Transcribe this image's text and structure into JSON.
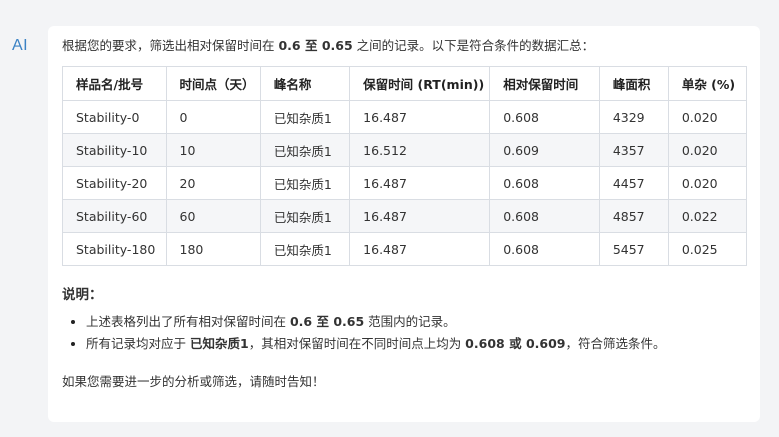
{
  "assistant_label": "AI",
  "intro": {
    "prefix": "根据您的要求，筛选出相对保留时间在 ",
    "low": "0.6",
    "mid": " 至 ",
    "high": "0.65",
    "suffix": " 之间的记录。以下是符合条件的数据汇总："
  },
  "table": {
    "headers": [
      "样品名/批号",
      "时间点（天）",
      "峰名称",
      "保留时间 (RT(min))",
      "相对保留时间",
      "峰面积",
      "单杂 (%)"
    ],
    "rows": [
      [
        "Stability-0",
        "0",
        "已知杂质1",
        "16.487",
        "0.608",
        "4329",
        "0.020"
      ],
      [
        "Stability-10",
        "10",
        "已知杂质1",
        "16.512",
        "0.609",
        "4357",
        "0.020"
      ],
      [
        "Stability-20",
        "20",
        "已知杂质1",
        "16.487",
        "0.608",
        "4457",
        "0.020"
      ],
      [
        "Stability-60",
        "60",
        "已知杂质1",
        "16.487",
        "0.608",
        "4857",
        "0.022"
      ],
      [
        "Stability-180",
        "180",
        "已知杂质1",
        "16.487",
        "0.608",
        "5457",
        "0.025"
      ]
    ]
  },
  "notes_title": "说明：",
  "notes": [
    {
      "a": "上述表格列出了所有相对保留时间在 ",
      "b": "0.6",
      "c": " 至 ",
      "d": "0.65",
      "e": " 范围内的记录。"
    },
    {
      "a": "所有记录均对应于 ",
      "b": "已知杂质1",
      "c": "，其相对保留时间在不同时间点上均为 ",
      "d": "0.608",
      "e": " 或 ",
      "f": "0.609",
      "g": "，符合筛选条件。"
    }
  ],
  "closing": "如果您需要进一步的分析或筛选，请随时告知！"
}
